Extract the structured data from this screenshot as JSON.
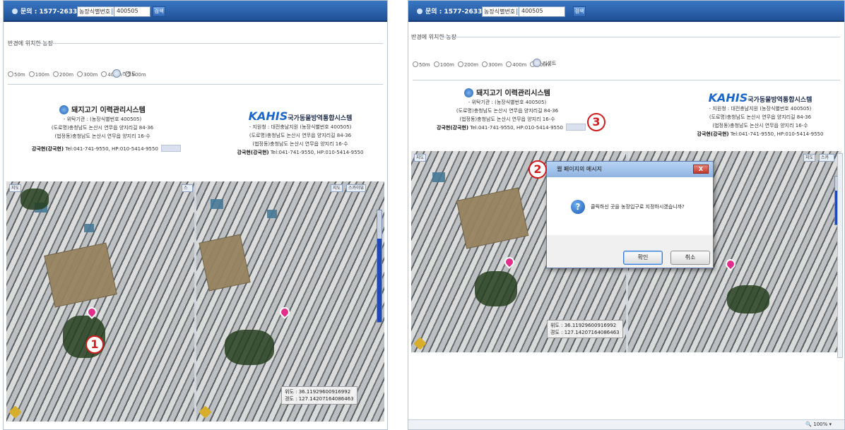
{
  "left": {
    "contact": "문의 : 1577-2633",
    "select": "농장식별번호",
    "farm_no": "400505",
    "search_label": "검색",
    "nearby_title": "반경에 위치한 농장",
    "radii": [
      "50m",
      "100m",
      "200m",
      "300m",
      "400m",
      "500m"
    ],
    "refresh_label": "리셋트",
    "card1": {
      "title": "돼지고기 이력관리시스템",
      "line1": "- 위탁기관 : (농장식별번호 400505)",
      "line2": "(도로명)충청남도 논산시 연무읍 양지리길 84-36",
      "line3": "(법정동)충청남도 논산시 연무읍 양지리 16-수",
      "manager": "강국현(강국현)",
      "phone": "Tel:041-741-9550, HP:010-5414-9550"
    },
    "card2": {
      "kahis": "KAHIS",
      "subtitle": "국가동물방역통합시스템",
      "line1": "- 지원청 : 대전충남지원 (농장식별번호 400505)",
      "line2": "(도로명)충청남도 논산시 연무읍 양지리길 84-36",
      "line3": "(법정동)충청남도 논산시 연무읍 양지리 16-수",
      "manager": "강국현(강국현)",
      "phone": "Tel:041-741-9550, HP:010-5414-9550"
    },
    "map_left_btn": "지도",
    "map_left_btn2": "스카이뷰",
    "map_right_btn": "지도",
    "map_right_btn2": "스카이뷰",
    "coord_lat": "위도 : 36.11929600916992",
    "coord_lng": "경도 : 127.14207164086463",
    "marker1": "1"
  },
  "right": {
    "contact": "문의 : 1577-2633",
    "select": "농장식별번호",
    "farm_no": "400505",
    "search_label": "검색",
    "nearby_title": "반경에 위치한 농장",
    "radii": [
      "50m",
      "100m",
      "200m",
      "300m",
      "400m",
      "500m"
    ],
    "refresh_label": "리셋트",
    "card1": {
      "title": "돼지고기 이력관리시스템",
      "line1": "- 위탁기관 : (농장식별번호 400505)",
      "line2": "(도로명)충청남도 논산시 연무읍 양지리길 84-36",
      "line3": "(법정동)충청남도 논산시 연무읍 양지리 16-수",
      "manager": "강국현(강국현)",
      "phone": "Tel:041-741-9550, HP:010-5414-9550"
    },
    "card2": {
      "kahis": "KAHIS",
      "subtitle": "국가동물방역통합시스템",
      "line1": "- 지원청 : 대전충남지원 (농장식별번호 400505)",
      "line2": "(도로명)충청남도 논산시 연무읍 양지리길 84-36",
      "line3": "(법정동)충청남도 논산시 연무읍 양지리 16-수",
      "manager": "강국현(강국현)",
      "phone": "Tel:041-741-9550, HP:010-5414-9550"
    },
    "map_left_btn": "지도",
    "map_right_btn": "지도",
    "map_right_btn2": "스카이뷰",
    "coord_lat": "위도 : 36.11929600916992",
    "coord_lng": "경도 : 127.14207164086463",
    "marker2": "2",
    "marker3": "3",
    "dialog": {
      "title": "웹 페이지의 메시지",
      "close": "X",
      "question": "클릭하신 곳을 농장입구로 지정하시겠습니까?",
      "ok": "확인",
      "cancel": "취소"
    },
    "zoom": "100%"
  },
  "colors": {
    "header": "#2a5fa8",
    "marker": "#d01c1c",
    "pin": "#e22d8a",
    "accent": "#1b66c9"
  },
  "icons": [
    "info-icon",
    "refresh-icon",
    "question-icon",
    "close-icon",
    "map-pin-icon",
    "compass-icon"
  ]
}
